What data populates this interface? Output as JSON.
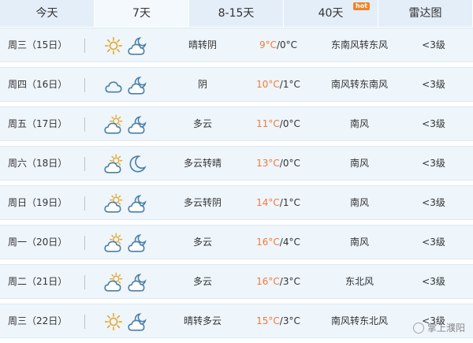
{
  "tabs": [
    {
      "label": "今天",
      "active": false
    },
    {
      "label": "7天",
      "active": true
    },
    {
      "label": "8-15天",
      "active": false
    },
    {
      "label": "40天",
      "active": false,
      "badge": "hot"
    },
    {
      "label": "雷达图",
      "active": false
    }
  ],
  "colors": {
    "tab_bar": "#e3eef8",
    "active_tab": "#f4f9fd",
    "row_bg": "#eef5fb",
    "high_temp": "#f07b3a",
    "icon": "#4a7fa8",
    "sun": "#e2a72c"
  },
  "rows": [
    {
      "date": "周三（15日）",
      "day_icon": "sun-icon",
      "night_icon": "moon-cloud-icon",
      "weather": "晴转阴",
      "high": "9°C",
      "low": "/0°C",
      "wind": "东南风转东风",
      "level": "<3级"
    },
    {
      "date": "周四（16日）",
      "day_icon": "cloud-icon",
      "night_icon": "moon-cloud-icon",
      "weather": "阴",
      "high": "10°C",
      "low": "/1°C",
      "wind": "南风转东南风",
      "level": "<3级"
    },
    {
      "date": "周五（17日）",
      "day_icon": "sun-cloud-icon",
      "night_icon": "moon-cloud-icon",
      "weather": "多云",
      "high": "11°C",
      "low": "/0°C",
      "wind": "南风",
      "level": "<3级"
    },
    {
      "date": "周六（18日）",
      "day_icon": "sun-cloud-icon",
      "night_icon": "moon-icon",
      "weather": "多云转晴",
      "high": "13°C",
      "low": "/0°C",
      "wind": "南风",
      "level": "<3级"
    },
    {
      "date": "周日（19日）",
      "day_icon": "sun-cloud-icon",
      "night_icon": "moon-cloud-icon",
      "weather": "多云转阴",
      "high": "14°C",
      "low": "/1°C",
      "wind": "南风",
      "level": "<3级"
    },
    {
      "date": "周一（20日）",
      "day_icon": "sun-cloud-icon",
      "night_icon": "moon-cloud-icon",
      "weather": "多云",
      "high": "16°C",
      "low": "/4°C",
      "wind": "南风",
      "level": "<3级"
    },
    {
      "date": "周二（21日）",
      "day_icon": "sun-cloud-icon",
      "night_icon": "moon-cloud-icon",
      "weather": "多云",
      "high": "16°C",
      "low": "/3°C",
      "wind": "东北风",
      "level": "<3级"
    },
    {
      "date": "周三（22日）",
      "day_icon": "sun-icon",
      "night_icon": "moon-cloud-icon",
      "weather": "晴转多云",
      "high": "15°C",
      "low": "/3°C",
      "wind": "南风转东北风",
      "level": "<3级"
    }
  ],
  "watermark": "掌上濮阳"
}
